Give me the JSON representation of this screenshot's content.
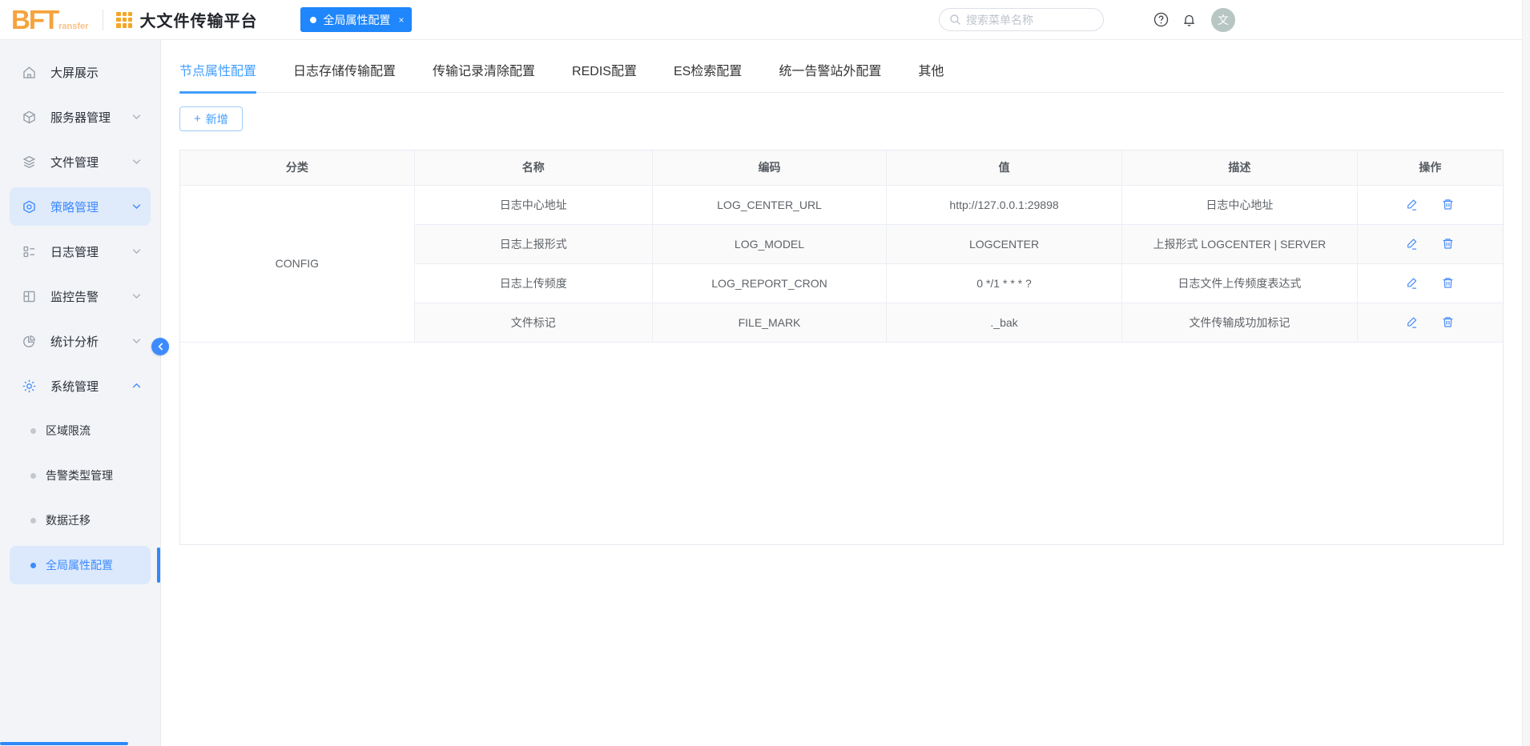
{
  "header": {
    "logo_text": "BFT",
    "logo_suffix": "ransfer",
    "app_title": "大文件传输平台",
    "tab_label": "全局属性配置",
    "tab_close": "×",
    "search_placeholder": "搜索菜单名称",
    "avatar_text": "文"
  },
  "sidebar": {
    "items": [
      {
        "label": "大屏展示",
        "icon": "home-icon"
      },
      {
        "label": "服务器管理",
        "icon": "server-icon"
      },
      {
        "label": "文件管理",
        "icon": "layers-icon"
      },
      {
        "label": "策略管理",
        "icon": "policy-cube-icon",
        "highlighted": true
      },
      {
        "label": "日志管理",
        "icon": "log-list-icon"
      },
      {
        "label": "监控告警",
        "icon": "monitor-icon"
      },
      {
        "label": "统计分析",
        "icon": "pie-chart-icon"
      },
      {
        "label": "系统管理",
        "icon": "gear-icon",
        "expanded": true
      }
    ],
    "sub_items": [
      {
        "label": "区域限流"
      },
      {
        "label": "告警类型管理"
      },
      {
        "label": "数据迁移"
      },
      {
        "label": "全局属性配置",
        "selected": true
      }
    ]
  },
  "tabs": [
    "节点属性配置",
    "日志存储传输配置",
    "传输记录清除配置",
    "REDIS配置",
    "ES检索配置",
    "统一告警站外配置",
    "其他"
  ],
  "toolbar": {
    "add_plus": "+",
    "add_label": "新增"
  },
  "table": {
    "columns": [
      "分类",
      "名称",
      "编码",
      "值",
      "描述",
      "操作"
    ],
    "category": "CONFIG",
    "rows": [
      {
        "name": "日志中心地址",
        "code": "LOG_CENTER_URL",
        "value": "http://127.0.0.1:29898",
        "desc": "日志中心地址"
      },
      {
        "name": "日志上报形式",
        "code": "LOG_MODEL",
        "value": "LOGCENTER",
        "desc": "上报形式 LOGCENTER | SERVER"
      },
      {
        "name": "日志上传频度",
        "code": "LOG_REPORT_CRON",
        "value": "0 */1 * * * ?",
        "desc": "日志文件上传频度表达式"
      },
      {
        "name": "文件标记",
        "code": "FILE_MARK",
        "value": "._bak",
        "desc": "文件传输成功加标记"
      }
    ]
  },
  "icons": {
    "search": "magnifier",
    "help": "question-circle",
    "notification": "bell",
    "edit": "pencil",
    "delete": "trash",
    "collapse": "chevron-left",
    "expand_more": "chevron-down",
    "expand_less": "chevron-up",
    "tab_dot": "dot"
  },
  "colors": {
    "primary": "#3d8bff",
    "tab_active": "#409eff",
    "header_tab_bg": "#1f86fb",
    "brand_orange": "#f5a33c",
    "sidebar_bg": "#f2f4f7",
    "selected_bg": "#dce9fc",
    "table_border": "#ebeef5",
    "stripe_bg": "#fafafa"
  }
}
